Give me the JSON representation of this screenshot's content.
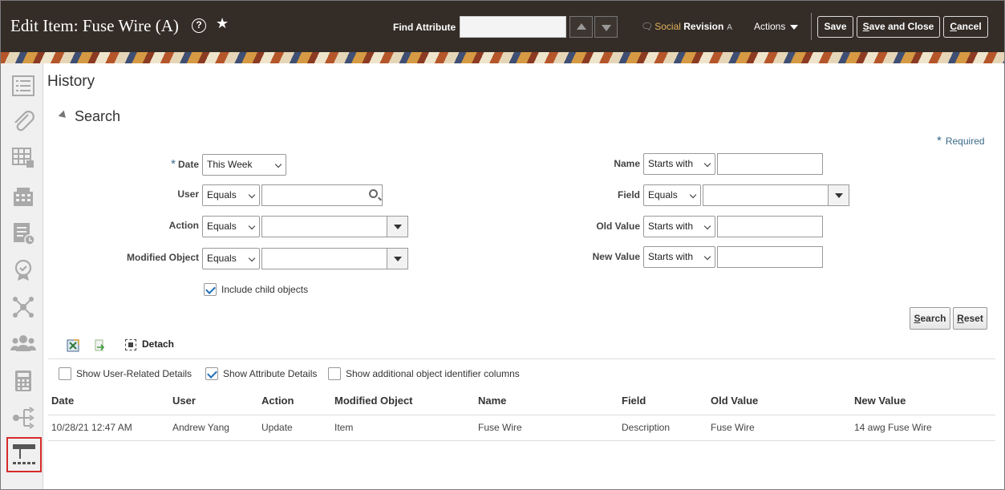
{
  "header": {
    "title": "Edit Item: Fuse Wire (A)",
    "help_icon": "?",
    "star_icon": "★",
    "find_attribute_label": "Find Attribute",
    "find_attribute_value": "",
    "social_prefix": "Social",
    "social_revision": "Revision",
    "social_icon": "speech-bubble-icon",
    "social_suffix": "A",
    "actions_label": "Actions",
    "save_label": "Save",
    "save_close_label_u": "S",
    "save_close_label_rest": "ave and Close",
    "cancel_label_u": "C",
    "cancel_label_rest": "ancel",
    "colors": {
      "background": "#332c27",
      "social_accent": "#e0b15c"
    }
  },
  "rail": {
    "items": [
      "overview-icon",
      "attachments-icon",
      "specifications-icon",
      "structure-icon",
      "pending-changes-icon",
      "approvals-icon",
      "relationships-icon",
      "people-icon",
      "calculator-icon",
      "where-used-icon",
      "history-icon"
    ],
    "active": "history-icon"
  },
  "main": {
    "title": "History",
    "search": {
      "heading": "Search",
      "required_label": "Required",
      "required_marker": "*",
      "date": {
        "label": "Date",
        "value": "This Week"
      },
      "user": {
        "label": "User",
        "operator": "Equals",
        "value": ""
      },
      "action": {
        "label": "Action",
        "operator": "Equals",
        "value": ""
      },
      "modified_object": {
        "label": "Modified Object",
        "operator": "Equals",
        "value": ""
      },
      "include_child": {
        "label": "Include child objects",
        "checked": true
      },
      "name": {
        "label": "Name",
        "operator": "Starts with",
        "value": ""
      },
      "field": {
        "label": "Field",
        "operator": "Equals",
        "value": ""
      },
      "old_value": {
        "label": "Old Value",
        "operator": "Starts with",
        "value": ""
      },
      "new_value": {
        "label": "New Value",
        "operator": "Starts with",
        "value": ""
      },
      "search_button_u": "S",
      "search_button_rest": "earch",
      "reset_button_u": "R",
      "reset_button_rest": "eset"
    },
    "toolbar": {
      "detach_label": "Detach",
      "icons": [
        "export-to-excel-icon",
        "export-icon",
        "detach-icon"
      ]
    },
    "options": {
      "show_user_details": {
        "label": "Show User-Related Details",
        "checked": false
      },
      "show_attribute_details": {
        "label": "Show Attribute Details",
        "checked": true
      },
      "show_additional_identifiers": {
        "label": "Show additional object identifier columns",
        "checked": false
      }
    },
    "table": {
      "columns": [
        "Date",
        "User",
        "Action",
        "Modified Object",
        "Name",
        "Field",
        "Old Value",
        "New Value"
      ],
      "rows": [
        [
          "10/28/21 12:47 AM",
          "Andrew Yang",
          "Update",
          "Item",
          "Fuse Wire",
          "Description",
          "Fuse Wire",
          "14 awg Fuse Wire"
        ]
      ]
    }
  }
}
